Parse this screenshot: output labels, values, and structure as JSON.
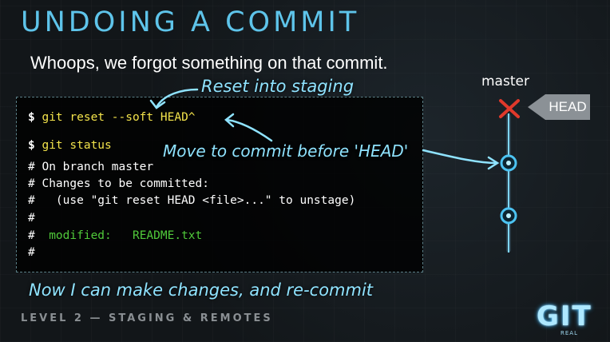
{
  "slide": {
    "title": "UNDOING A COMMIT",
    "subtitle": "Whoops, we forgot something on that commit.",
    "footer": "LEVEL 2 — STAGING & REMOTES"
  },
  "terminal": {
    "line1_prompt": "$ ",
    "line1_cmd": "git reset --soft HEAD^",
    "line2_prompt": "$ ",
    "line2_cmd": "git status",
    "line3": "# On branch master",
    "line4": "# Changes to be committed:",
    "line5": "#   (use \"git reset HEAD <file>...\" to unstage)",
    "line6": "#",
    "line7_hash": "#  ",
    "line7_status": "modified:   README.txt",
    "line8": "#"
  },
  "annotations": {
    "reset_into_staging": "Reset into staging",
    "move_to_commit": "Move to commit before 'HEAD'",
    "now_recommit": "Now I can make changes, and re-commit"
  },
  "graph": {
    "branch_label": "master",
    "head_label": "HEAD"
  },
  "logo": {
    "text": "GIT",
    "subtext": "REAL"
  },
  "colors": {
    "title": "#5ec4ea",
    "annotation": "#8fe3ff",
    "command": "#f3e34b",
    "modified": "#50c93a",
    "removed_commit": "#e0392b",
    "head_tag": "#8b9196"
  }
}
